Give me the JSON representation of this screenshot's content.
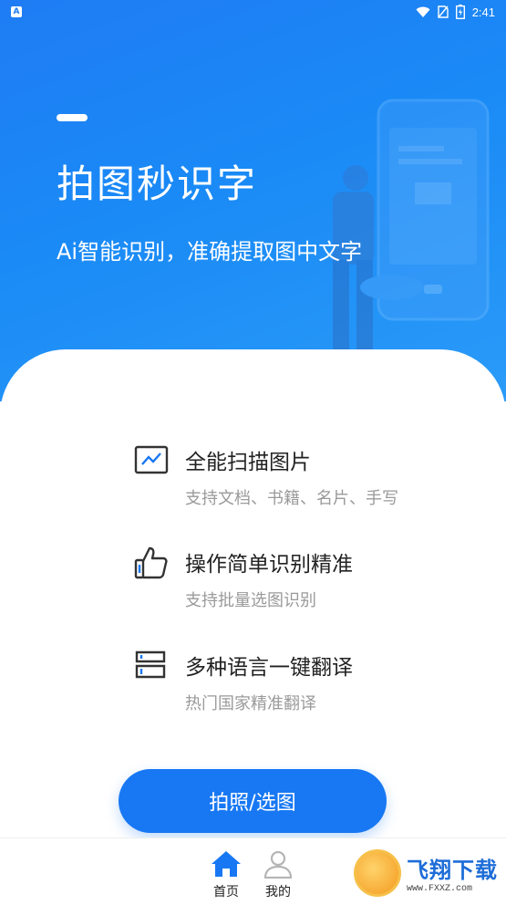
{
  "status_bar": {
    "app_icon_letter": "A",
    "time": "2:41"
  },
  "hero": {
    "title": "拍图秒识字",
    "subtitle": "Ai智能识别，准确提取图中文字"
  },
  "features": [
    {
      "icon": "image-chart-icon",
      "title": "全能扫描图片",
      "description": "支持文档、书籍、名片、手写"
    },
    {
      "icon": "thumbs-up-icon",
      "title": "操作简单识别精准",
      "description": "支持批量选图识别"
    },
    {
      "icon": "translate-icon",
      "title": "多种语言一键翻译",
      "description": "热门国家精准翻译"
    }
  ],
  "primary_button": {
    "label": "拍照/选图"
  },
  "tabbar": {
    "items": [
      {
        "label": "首页",
        "icon": "home-icon",
        "active": true
      },
      {
        "label": "我的",
        "icon": "user-icon",
        "active": false
      }
    ]
  },
  "watermark": {
    "main": "飞翔下载",
    "sub": "www.FXXZ.com"
  },
  "colors": {
    "primary": "#1878f3",
    "hero_gradient_start": "#1f7cf4",
    "hero_gradient_end": "#2a9bf8",
    "secondary_text": "#9a9a9a"
  }
}
